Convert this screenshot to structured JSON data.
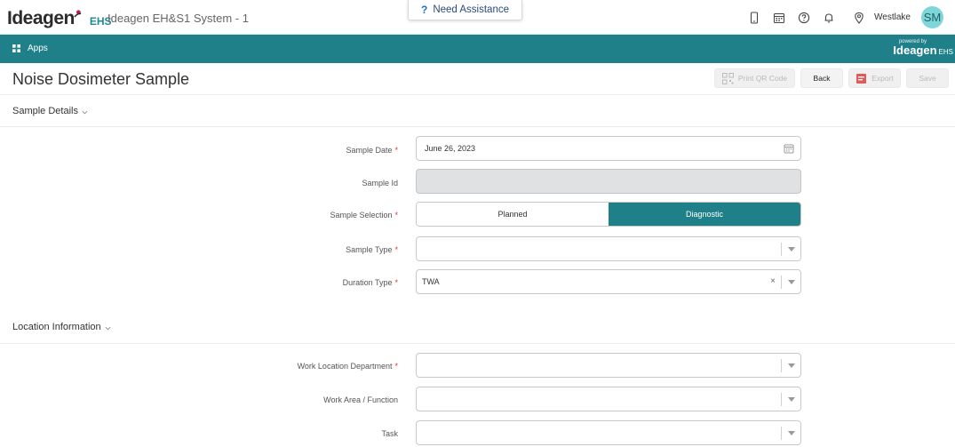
{
  "header": {
    "logo_main": "Ideagen",
    "logo_sub": "EHS",
    "system_title": "Ideagen EH&S1 System - 1",
    "assist_label": "Need Assistance",
    "location_label": "Westlake",
    "avatar_initials": "SM"
  },
  "appsbar": {
    "apps_label": "Apps",
    "powered_by": "powered by",
    "powered_brand": "Ideagen",
    "powered_sub": "EHS"
  },
  "page": {
    "title": "Noise Dosimeter Sample",
    "actions": {
      "print_qr": "Print QR Code",
      "back": "Back",
      "export": "Export",
      "save": "Save"
    }
  },
  "sample_details": {
    "section_title": "Sample Details",
    "sample_date_label": "Sample Date",
    "sample_date_value": "June 26, 2023",
    "sample_id_label": "Sample Id",
    "sample_selection_label": "Sample Selection",
    "selection_options": [
      "Planned",
      "Diagnostic"
    ],
    "selected_option": "Diagnostic",
    "sample_type_label": "Sample Type",
    "duration_type_label": "Duration Type",
    "duration_type_value": "TWA"
  },
  "location_info": {
    "section_title": "Location Information",
    "work_location_label": "Work Location Department",
    "work_area_label": "Work Area / Function",
    "task_label": "Task"
  },
  "required_mark": "*",
  "clear_glyph": "×",
  "colors": {
    "teal": "#1f8089",
    "accent_red": "#d33"
  }
}
